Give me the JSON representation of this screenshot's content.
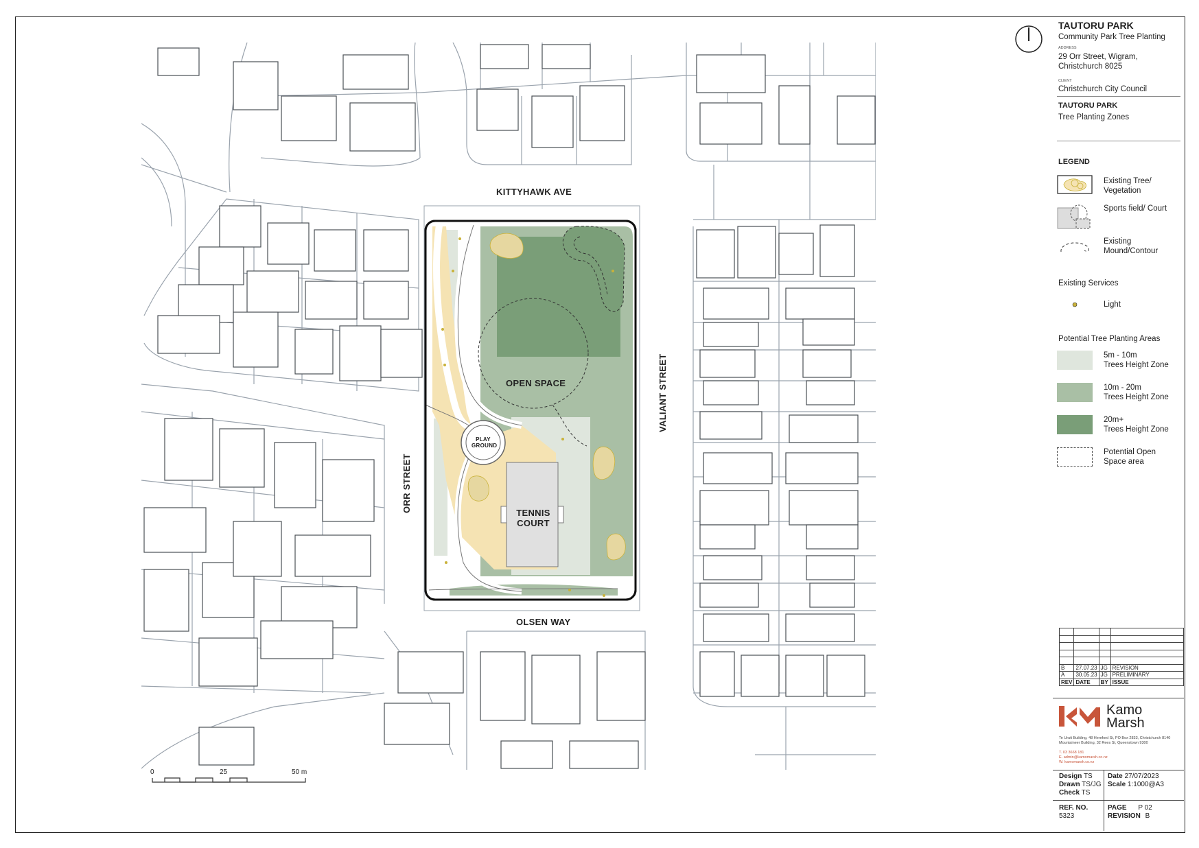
{
  "map": {
    "streets": {
      "north": "KITTYHAWK AVE",
      "south": "OLSEN WAY",
      "west": "ORR STREET",
      "east": "VALIANT STREET"
    },
    "areas": {
      "open_space": "OPEN SPACE",
      "playground_line1": "PLAY",
      "playground_line2": "GROUND",
      "tennis_line1": "TENNIS",
      "tennis_line2": "COURT"
    },
    "scale_bar": {
      "t0": "0",
      "t1": "25",
      "t2": "50 m"
    },
    "north_arrow_icon": "north-arrow-icon"
  },
  "title_block": {
    "project": "TAUTORU PARK",
    "subtitle": "Community Park Tree Planting",
    "address_label": "ADDRESS",
    "address_line1": "29 Orr Street, Wigram,",
    "address_line2": "Christchurch 8025",
    "client_label": "CLIENT",
    "client": "Christchurch City Council",
    "drawing_title": "TAUTORU PARK",
    "drawing_subtitle": "Tree Planting Zones"
  },
  "legend": {
    "heading": "LEGEND",
    "existing_tree_1": "Existing Tree/",
    "existing_tree_2": "Vegetation",
    "sports_field": "Sports field/ Court",
    "mound_1": "Existing",
    "mound_2": "Mound/Contour",
    "services_heading": "Existing Services",
    "light": "Light",
    "planting_heading": "Potential Tree Planting Areas",
    "zone1_1": "5m - 10m",
    "zone1_2": "Trees Height Zone",
    "zone2_1": "10m - 20m",
    "zone2_2": "Trees Height Zone",
    "zone3_1": "20m+",
    "zone3_2": "Trees Height Zone",
    "open_1": "Potential Open",
    "open_2": "Space area",
    "colors": {
      "zone_5_10": "#dfe6dd",
      "zone_10_20": "#a9bfa5",
      "zone_20_plus": "#7a9e78",
      "existing_tree": "#f5e3b3",
      "light": "#c9b23a"
    }
  },
  "revisions": {
    "rows": [
      {
        "rev": "B",
        "date": "27.07.23",
        "by": "JG",
        "issue": "REVISION"
      },
      {
        "rev": "A",
        "date": "30.05.23",
        "by": "JG",
        "issue": "PRELIMINARY"
      }
    ],
    "headers": {
      "rev": "REV",
      "date": "DATE",
      "by": "BY",
      "issue": "ISSUE"
    }
  },
  "company": {
    "name_1": "Kamo",
    "name_2": "Marsh",
    "address_1": "Te Uruti Building, 48 Hereford St, PO Box 2833, Christchurch 8140",
    "address_2": "Mountaineer Building, 32 Rees St, Queenstown 9300",
    "phone": "T.  03 3668 181",
    "email": "E.  admin@kamomarsh.co.nz",
    "web": "W.  kamomarsh.co.nz",
    "brand_color": "#c8553a"
  },
  "meta": {
    "design_label": "Design",
    "design": "TS",
    "drawn_label": "Drawn",
    "drawn": "TS/JG",
    "check_label": "Check",
    "check": "TS",
    "date_label": "Date",
    "date": "27/07/2023",
    "scale_label": "Scale",
    "scale": "1:1000@A3",
    "ref_label": "REF. NO.",
    "ref": "5323",
    "page_label": "PAGE",
    "page": "P 02",
    "revision_label": "REVISION",
    "revision": "B"
  }
}
